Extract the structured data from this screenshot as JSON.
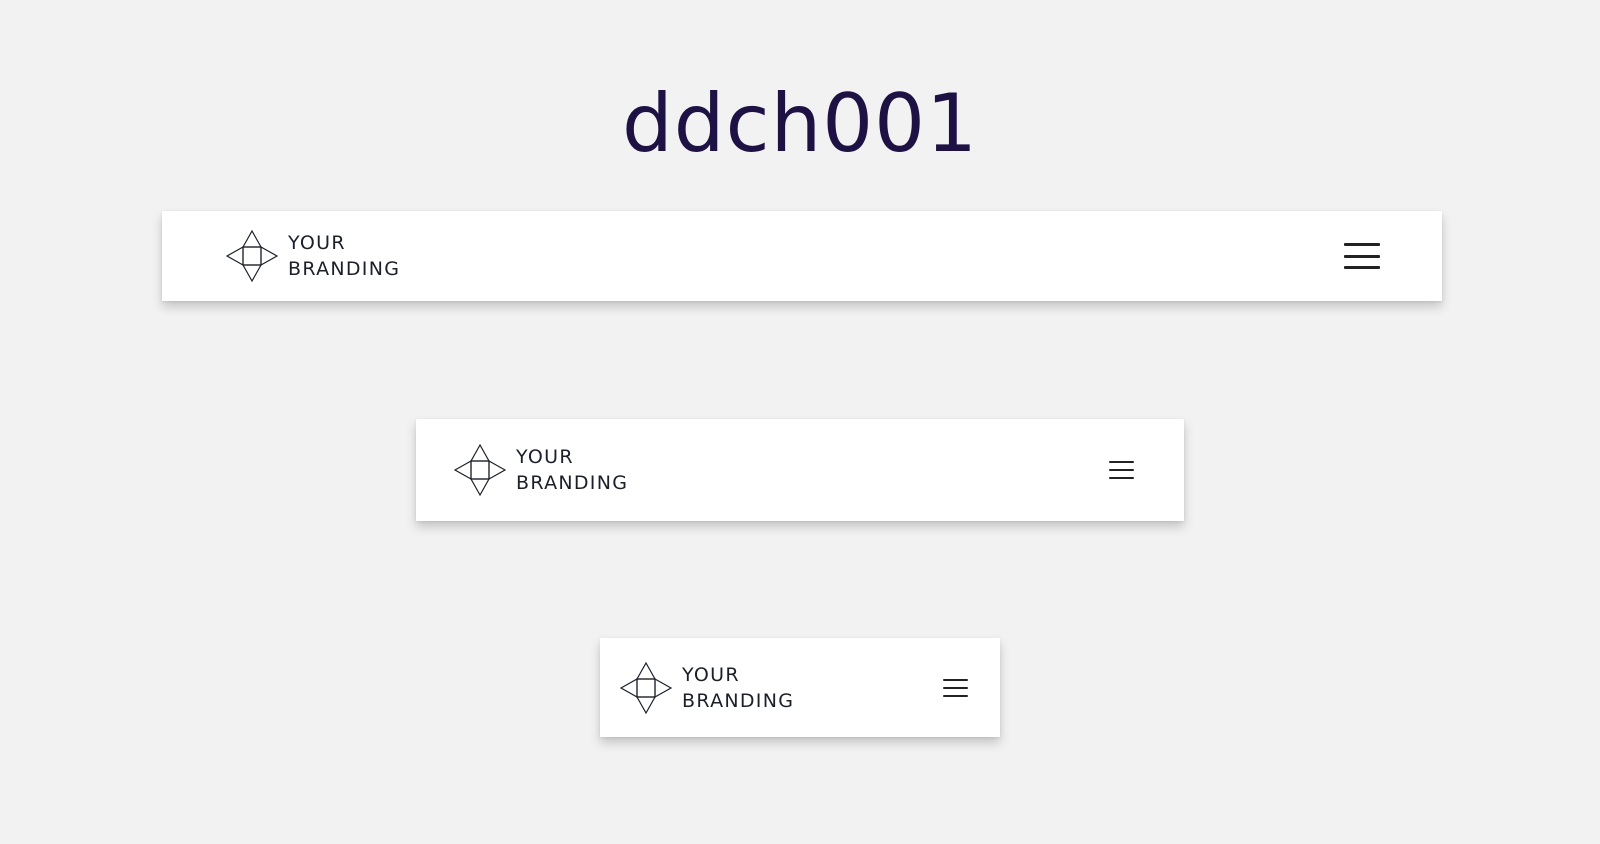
{
  "page": {
    "title": "ddch001"
  },
  "navbars": [
    {
      "brand_line1": "YOUR",
      "brand_line2": "BRANDING",
      "menu_icon": "hamburger-icon"
    },
    {
      "brand_line1": "YOUR",
      "brand_line2": "BRANDING",
      "menu_icon": "hamburger-icon"
    },
    {
      "brand_line1": "YOUR",
      "brand_line2": "BRANDING",
      "menu_icon": "hamburger-icon"
    }
  ],
  "colors": {
    "background": "#f2f2f2",
    "title": "#1e1245",
    "brand_text": "#1c1f2a",
    "navbar": "#ffffff"
  }
}
